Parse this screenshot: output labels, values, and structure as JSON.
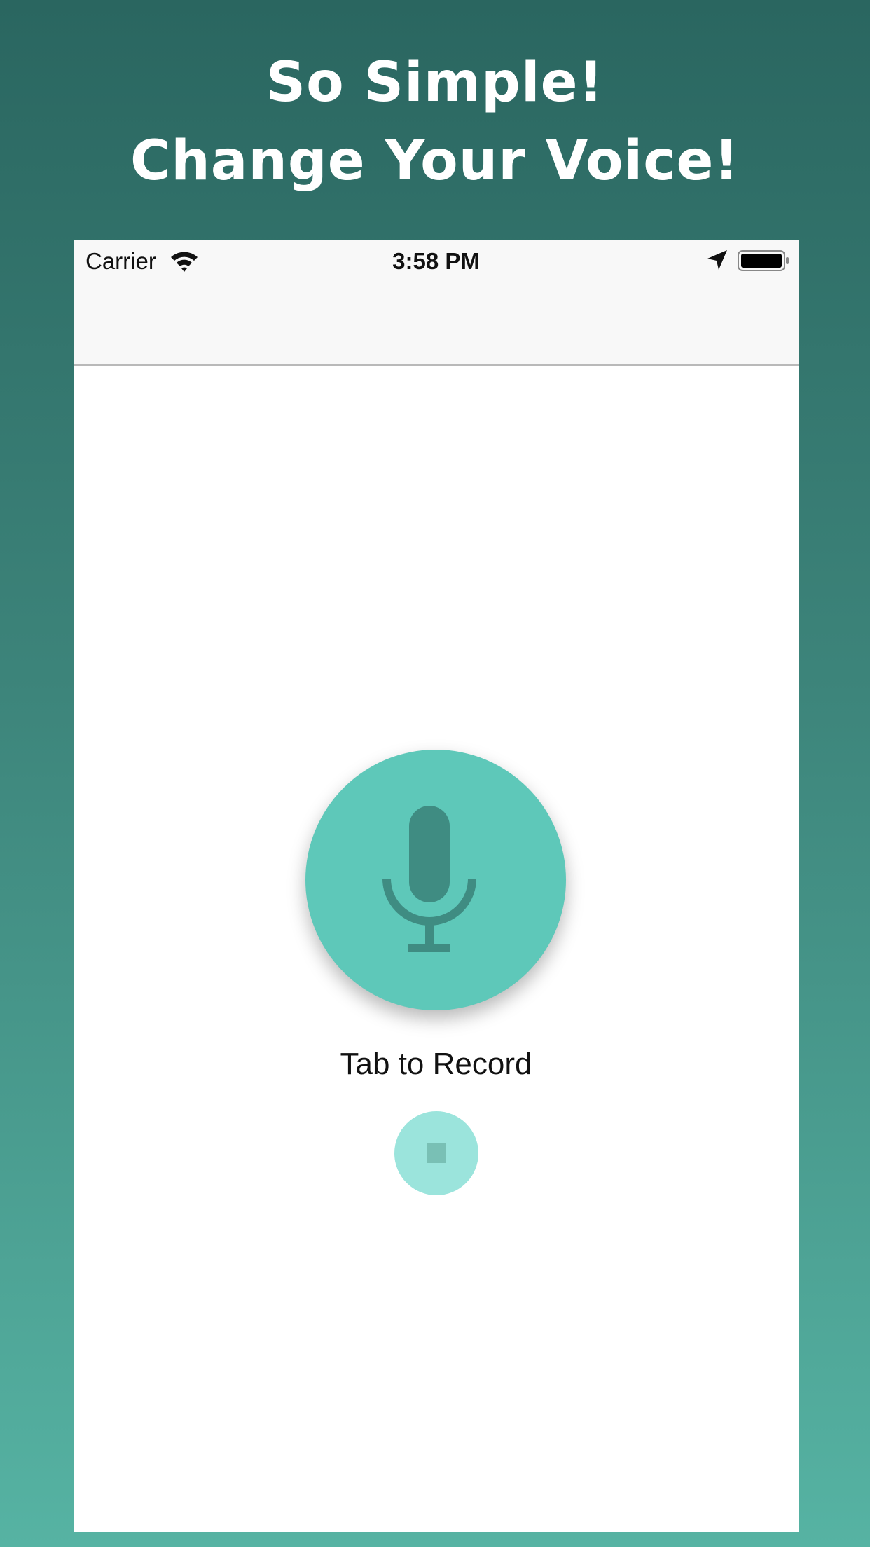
{
  "promo": {
    "headline_line1": "So Simple!",
    "headline_line2": "Change Your Voice!"
  },
  "status_bar": {
    "carrier": "Carrier",
    "time": "3:58 PM",
    "icons": [
      "wifi-icon",
      "location-arrow-icon",
      "battery-icon"
    ]
  },
  "recorder": {
    "record_icon": "microphone-icon",
    "label": "Tab to Record",
    "stop_icon": "stop-icon"
  },
  "colors": {
    "background_top": "#2a6660",
    "background_bottom": "#56b3a3",
    "record_button": "#5ec8b9",
    "mic_glyph": "#3f8c82",
    "stop_button": "#9be4dc",
    "stop_square": "#79c0b5"
  }
}
